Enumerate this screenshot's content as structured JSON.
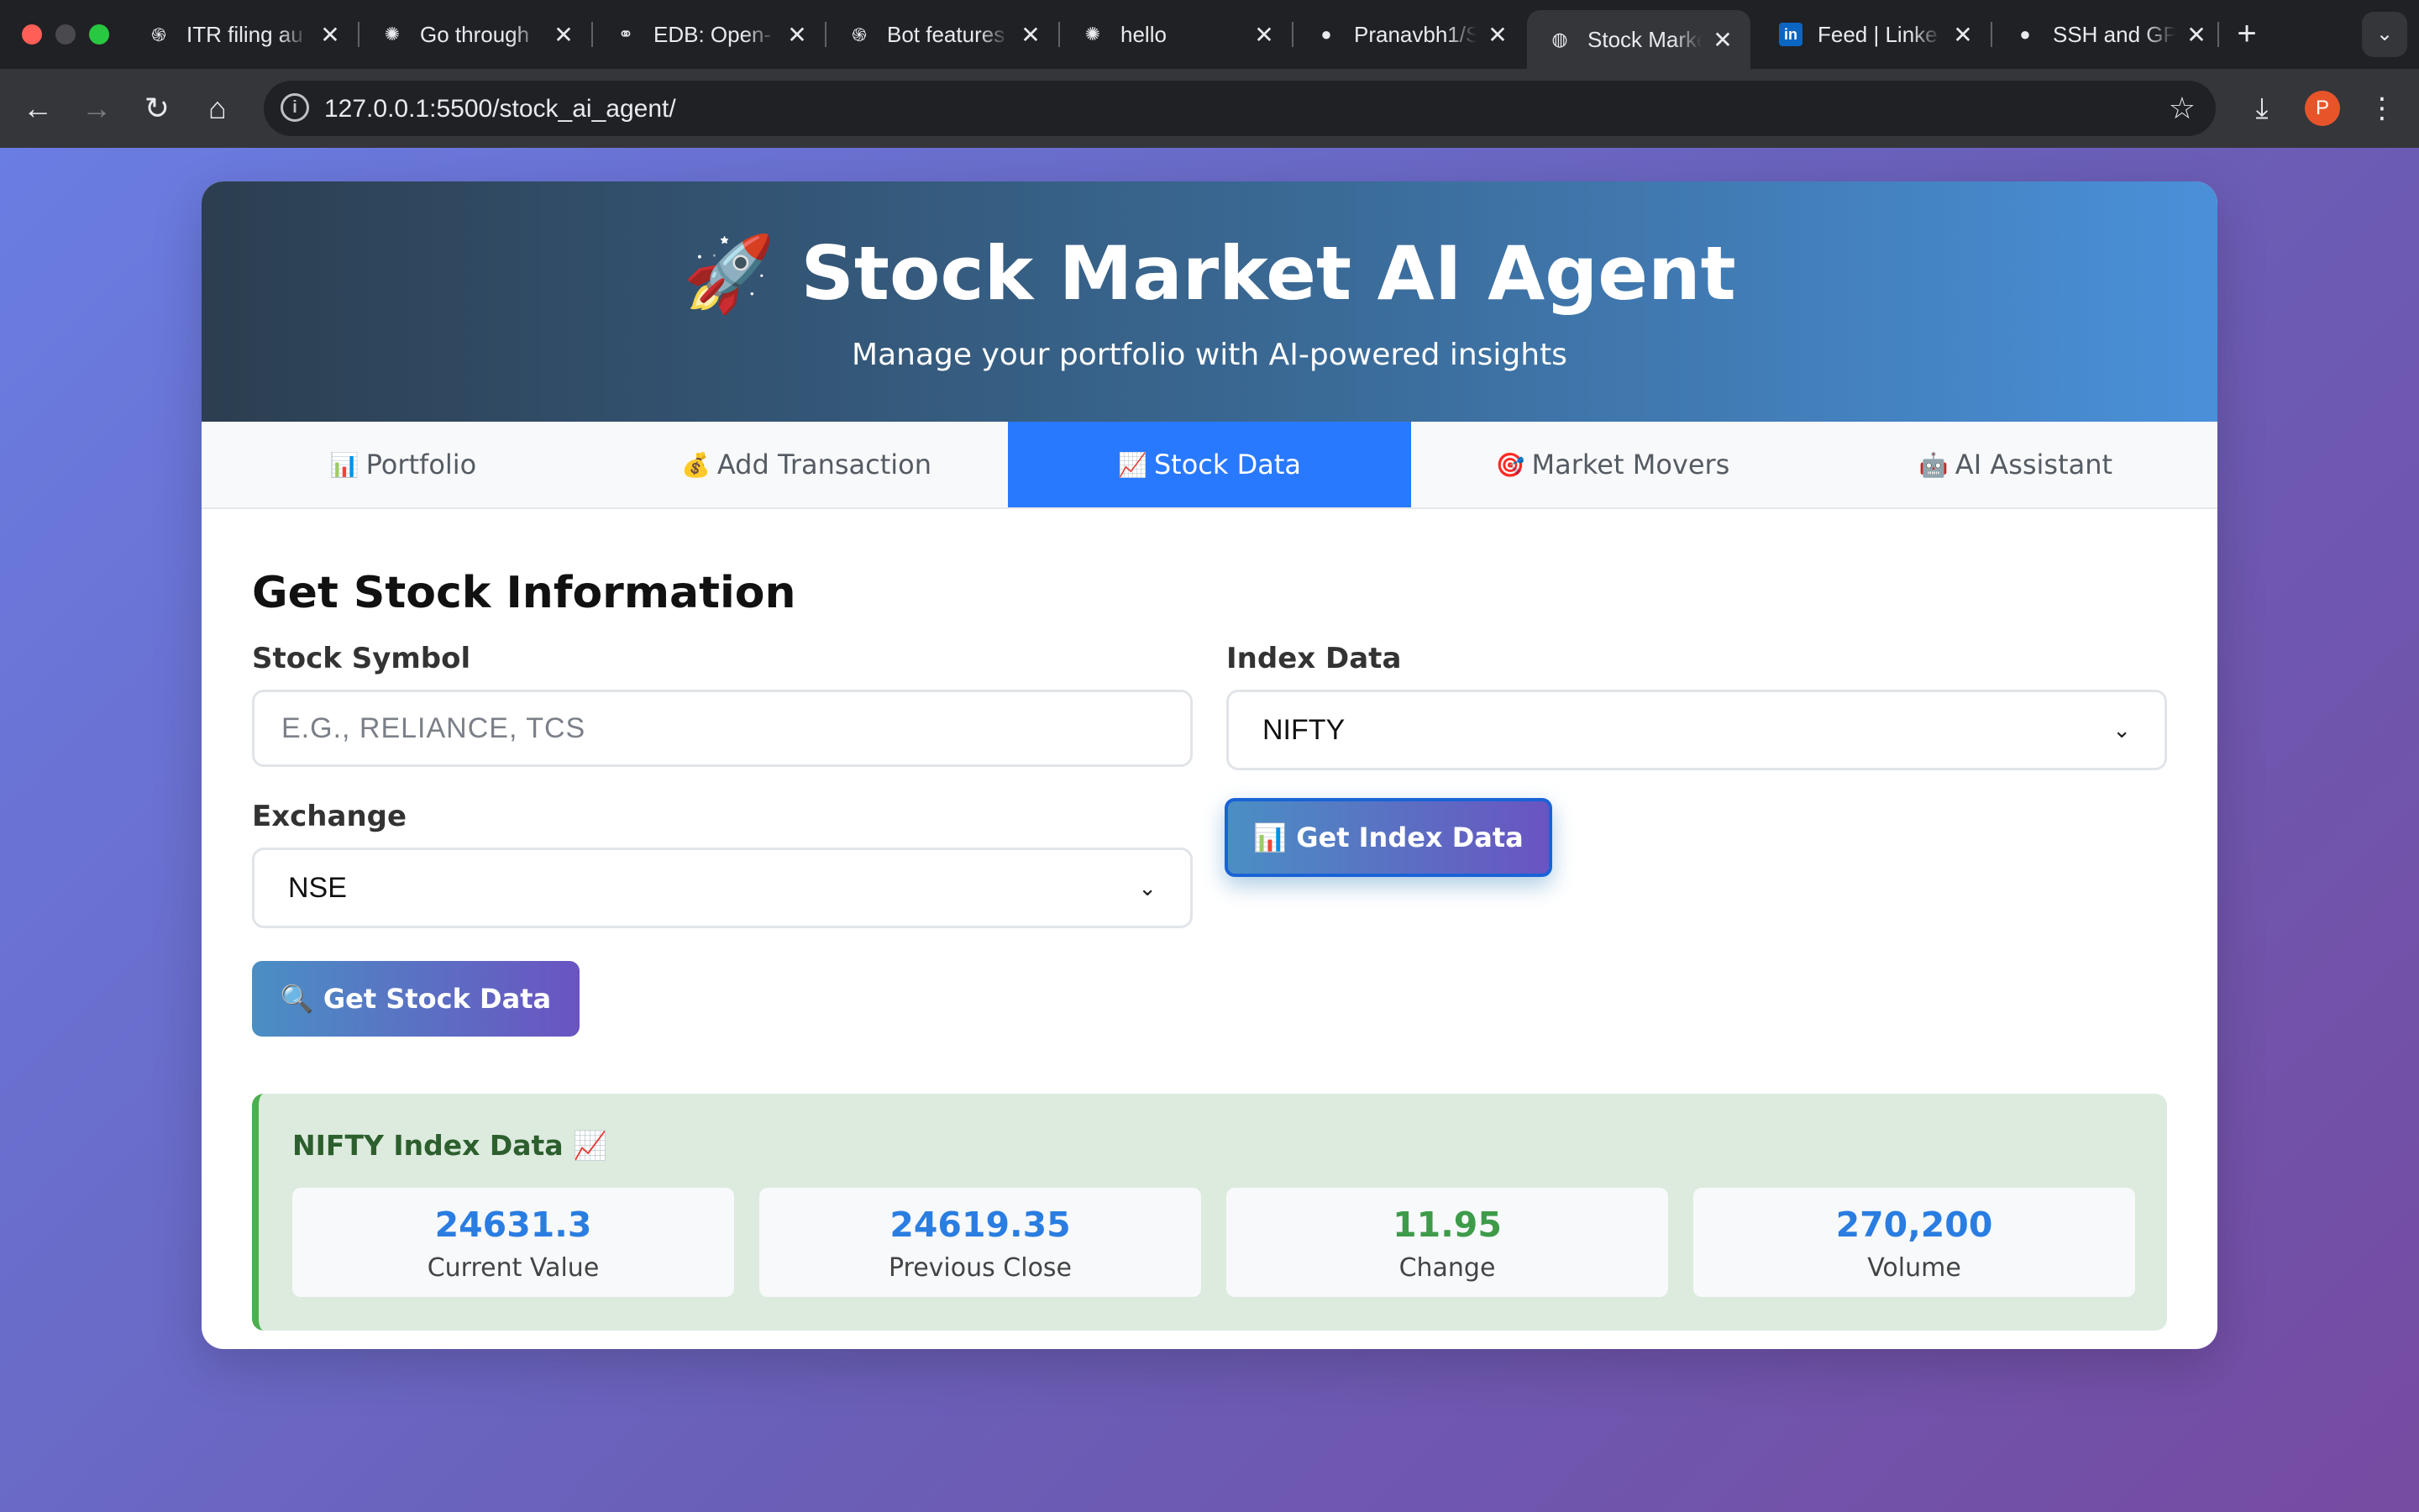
{
  "browser": {
    "tabs": [
      {
        "title": "ITR filing au",
        "icon": "openai-icon",
        "glyph": "֍"
      },
      {
        "title": "Go through",
        "icon": "cursor-app-icon",
        "glyph": "✺"
      },
      {
        "title": "EDB: Open-",
        "icon": "edb-icon",
        "glyph": "⚭"
      },
      {
        "title": "Bot features",
        "icon": "openai-icon",
        "glyph": "֍"
      },
      {
        "title": "hello",
        "icon": "cursor-app-icon",
        "glyph": "✺"
      },
      {
        "title": "Pranavbh1/S",
        "icon": "github-icon",
        "glyph": "●"
      },
      {
        "title": "Stock Marke",
        "icon": "globe-icon",
        "glyph": "◍",
        "active": true
      },
      {
        "title": "Feed | Linke",
        "icon": "linkedin-icon",
        "glyph": "in"
      },
      {
        "title": "SSH and GP",
        "icon": "github-icon",
        "glyph": "●"
      }
    ],
    "close_glyph": "✕",
    "new_tab_glyph": "+",
    "tab_menu_glyph": "⌄",
    "url": "127.0.0.1:5500/stock_ai_agent/",
    "site_info_glyph": "i",
    "avatar_initial": "P",
    "back_glyph": "←",
    "forward_glyph": "→",
    "reload_glyph": "↻",
    "home_glyph": "⌂",
    "star_glyph": "☆",
    "download_glyph": "⤓",
    "menu_glyph": "⋮"
  },
  "app": {
    "title": "🚀 Stock Market AI Agent",
    "subtitle": "Manage your portfolio with AI-powered insights",
    "tabs": [
      {
        "icon": "📊",
        "label": "Portfolio"
      },
      {
        "icon": "💰",
        "label": "Add Transaction"
      },
      {
        "icon": "📈",
        "label": "Stock Data",
        "active": true
      },
      {
        "icon": "🎯",
        "label": "Market Movers"
      },
      {
        "icon": "🤖",
        "label": "AI Assistant"
      }
    ]
  },
  "form": {
    "heading": "Get Stock Information",
    "symbol_label": "Stock Symbol",
    "symbol_placeholder": "E.G., RELIANCE, TCS",
    "symbol_value": "",
    "exchange_label": "Exchange",
    "exchange_value": "NSE",
    "index_label": "Index Data",
    "index_value": "NIFTY",
    "get_stock_button": "🔍 Get Stock Data",
    "get_index_button": "📊 Get Index Data",
    "chevron": "⌄"
  },
  "result": {
    "title": "NIFTY Index Data 📈",
    "metrics": [
      {
        "value": "24631.3",
        "label": "Current Value"
      },
      {
        "value": "24619.35",
        "label": "Previous Close"
      },
      {
        "value": "11.95",
        "label": "Change",
        "positive": true
      },
      {
        "value": "270,200",
        "label": "Volume"
      }
    ]
  },
  "colors": {
    "accent": "#2979ff",
    "positive": "#3e9b4a",
    "result_border": "#4caf50"
  }
}
